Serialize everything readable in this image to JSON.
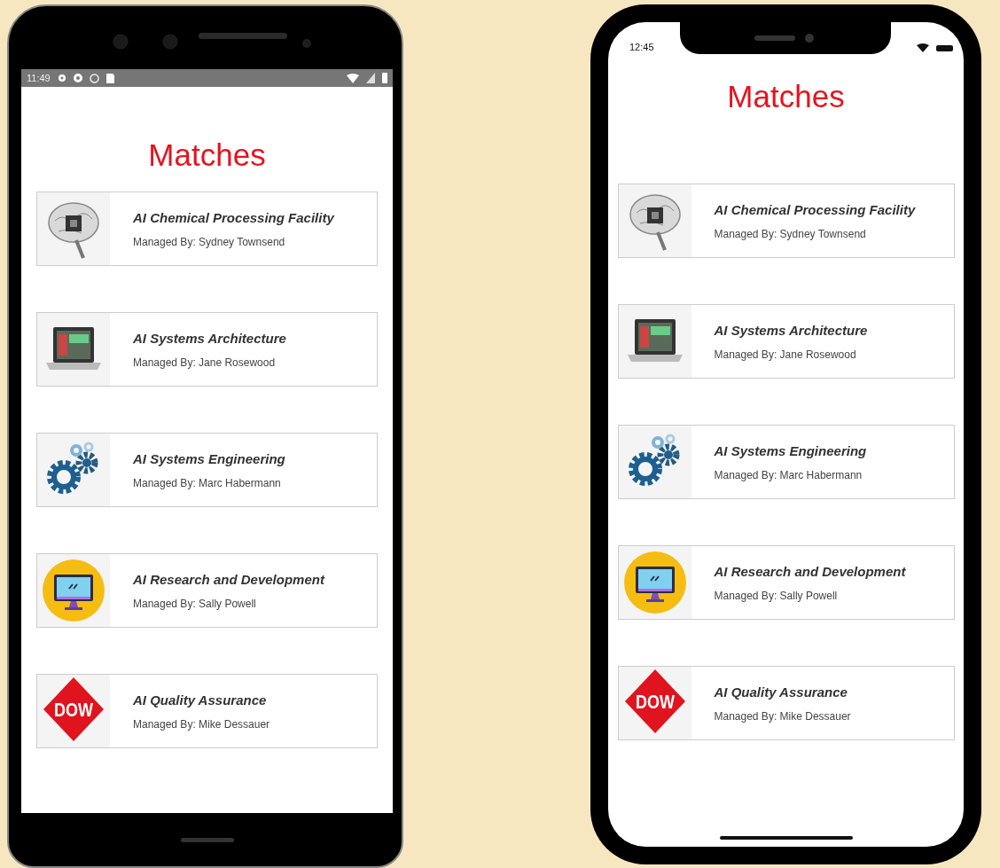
{
  "phones": [
    {
      "kind": "android",
      "status_time": "11:49",
      "title": "Matches",
      "items": [
        {
          "kind": "brain",
          "title": "AI Chemical Processing Facility",
          "manager": "Managed By: Sydney Townsend"
        },
        {
          "kind": "laptop",
          "title": "AI Systems Architecture",
          "manager": "Managed By: Jane Rosewood"
        },
        {
          "kind": "gears",
          "title": "AI Systems Engineering",
          "manager": "Managed By: Marc Habermann"
        },
        {
          "kind": "monitor",
          "title": "AI Research and Development",
          "manager": "Managed By: Sally Powell"
        },
        {
          "kind": "logo",
          "logo_text": "DOW",
          "title": "AI Quality Assurance",
          "manager": "Managed By: Mike Dessauer"
        }
      ]
    },
    {
      "kind": "iphone",
      "status_time": "12:45",
      "title": "Matches",
      "items": [
        {
          "kind": "brain",
          "title": "AI Chemical Processing Facility",
          "manager": "Managed By: Sydney Townsend"
        },
        {
          "kind": "laptop",
          "title": "AI Systems Architecture",
          "manager": "Managed By: Jane Rosewood"
        },
        {
          "kind": "gears",
          "title": "AI Systems Engineering",
          "manager": "Managed By: Marc Habermann"
        },
        {
          "kind": "monitor",
          "title": "AI Research and Development",
          "manager": "Managed By: Sally Powell"
        },
        {
          "kind": "logo",
          "logo_text": "DOW",
          "title": "AI Quality Assurance",
          "manager": "Managed By: Mike Dessauer"
        }
      ]
    }
  ]
}
